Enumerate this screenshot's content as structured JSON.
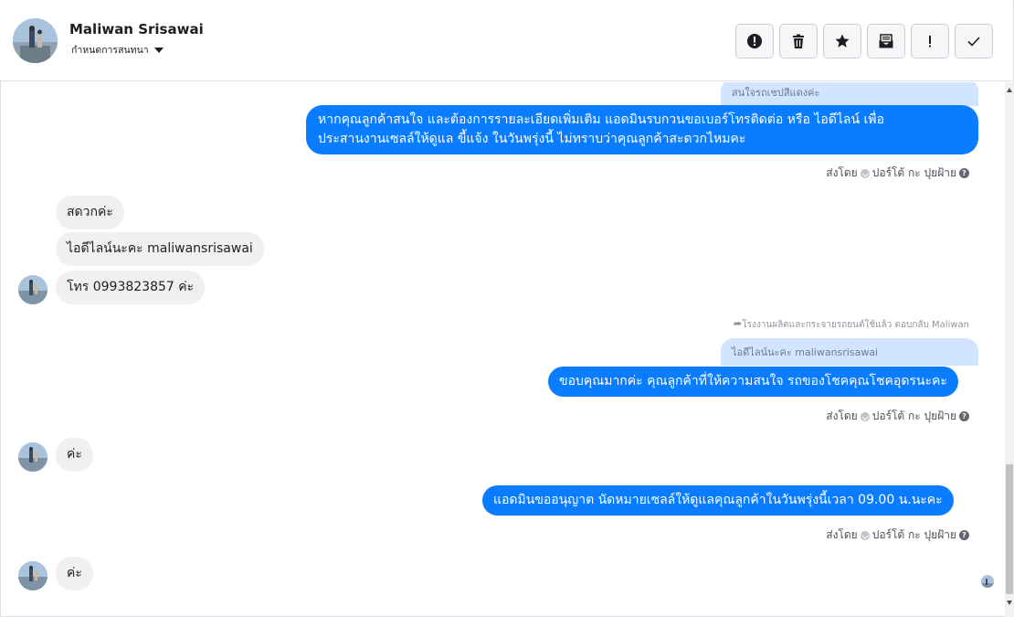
{
  "header": {
    "contact_name": "Maliwan Srisawai",
    "subtitle": "กำหนดการสนทนา",
    "actions": [
      "alert-icon",
      "trash-icon",
      "star-icon",
      "mail-icon",
      "exclamation-icon",
      "check-icon"
    ]
  },
  "messages": {
    "quote_1": "สนใจรถเชปสีแดงค่ะ",
    "out_1_line1": "หากคุณลูกค้าสนใจ และต้องการรายละเอียดเพิ่มเติม แอดมินรบกวนขอเบอร์โทรติดต่อ หรือ ไอดีไลน์ เพื่อ",
    "out_1_line2": "ประสานงานเซลล์ให้ดูแล ขี้แจ้ง ในวันพรุ่งนี้ ไม่ทราบว่าคุณลูกค้าสะดวกไหมคะ",
    "sent_by_1_label": "ส่งโดย",
    "sent_by_1_name": "ปอร์โต้ กะ ปุยฝ้าย",
    "in_1": "สดวกค่ะ",
    "in_2": "ไอดีไลน์นะคะ maliwansrisawai",
    "in_3": "โทร 0993823857 ค่ะ",
    "reply_note": "โรงงานผลิตและกระจายรถยนต์ใช้แล้ว ตอบกลับ Maliwan",
    "quote_2": "ไอดีไลน์นะคะ maliwansrisawai",
    "out_2": "ขอบคุณมากค่ะ คุณลูกค้าที่ให้ความสนใจ รถของโชคคุณโชคอุดรนะคะ",
    "sent_by_2_label": "ส่งโดย",
    "sent_by_2_name": "ปอร์โต้ กะ ปุยฝ้าย",
    "in_4": "ค่ะ",
    "out_3": "แอดมินขออนุญาต นัดหมายเซลล์ให้ดูแลคุณลูกค้าในวันพรุ่งนี้เวลา 09.00 น.นะคะ",
    "sent_by_3_label": "ส่งโดย",
    "sent_by_3_name": "ปอร์โต้ กะ ปุยฝ้าย",
    "in_5": "ค่ะ"
  },
  "colors": {
    "outgoing_bubble": "#0a7cff",
    "incoming_bubble": "#f0f0f0",
    "quote_bubble": "#d2e5ff"
  }
}
